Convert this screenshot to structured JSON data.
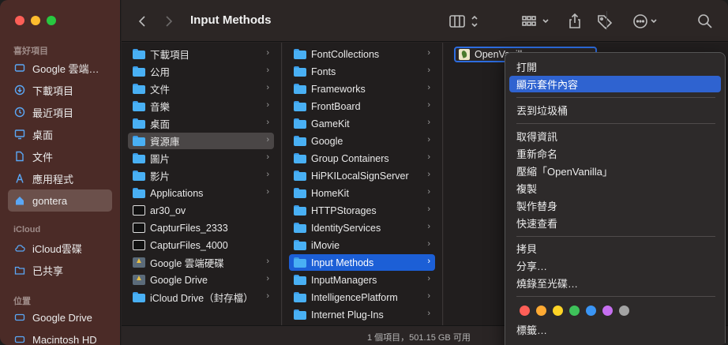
{
  "window": {
    "title": "Input Methods"
  },
  "sidebar": {
    "favorites_header": "喜好項目",
    "icloud_header": "iCloud",
    "locations_header": "位置",
    "favorites": [
      {
        "label": "Google 雲端…",
        "icon": "cloud-drive-icon"
      },
      {
        "label": "下載項目",
        "icon": "download-icon"
      },
      {
        "label": "最近項目",
        "icon": "clock-icon"
      },
      {
        "label": "桌面",
        "icon": "desktop-icon"
      },
      {
        "label": "文件",
        "icon": "document-icon"
      },
      {
        "label": "應用程式",
        "icon": "applications-icon"
      },
      {
        "label": "gontera",
        "icon": "home-icon"
      }
    ],
    "icloud": [
      {
        "label": "iCloud雲碟",
        "icon": "cloud-icon"
      },
      {
        "label": "已共享",
        "icon": "shared-folder-icon"
      }
    ],
    "locations": [
      {
        "label": "Google Drive",
        "icon": "drive-icon"
      },
      {
        "label": "Macintosh HD",
        "icon": "disk-icon"
      }
    ]
  },
  "column1": [
    {
      "label": "下載項目",
      "icon": "folder",
      "chevron": true
    },
    {
      "label": "公用",
      "icon": "folder",
      "chevron": true
    },
    {
      "label": "文件",
      "icon": "folder",
      "chevron": true
    },
    {
      "label": "音樂",
      "icon": "folder",
      "chevron": true
    },
    {
      "label": "桌面",
      "icon": "folder",
      "chevron": true
    },
    {
      "label": "資源庫",
      "icon": "folder",
      "chevron": true,
      "selected": true
    },
    {
      "label": "圖片",
      "icon": "folder",
      "chevron": true
    },
    {
      "label": "影片",
      "icon": "folder",
      "chevron": true
    },
    {
      "label": "Applications",
      "icon": "folder",
      "chevron": true
    },
    {
      "label": "ar30_ov",
      "icon": "file",
      "chevron": false
    },
    {
      "label": "CapturFiles_2333",
      "icon": "file",
      "chevron": false
    },
    {
      "label": "CapturFiles_4000",
      "icon": "file",
      "chevron": false
    },
    {
      "label": "Google 雲端硬碟",
      "icon": "gdrive",
      "chevron": true
    },
    {
      "label": "Google Drive",
      "icon": "gdrive",
      "chevron": true
    },
    {
      "label": "iCloud Drive（封存檔）",
      "icon": "folder",
      "chevron": true
    }
  ],
  "column2": [
    {
      "label": "FontCollections"
    },
    {
      "label": "Fonts"
    },
    {
      "label": "Frameworks"
    },
    {
      "label": "FrontBoard"
    },
    {
      "label": "GameKit"
    },
    {
      "label": "Google"
    },
    {
      "label": "Group Containers"
    },
    {
      "label": "HiPKILocalSignServer"
    },
    {
      "label": "HomeKit"
    },
    {
      "label": "HTTPStorages"
    },
    {
      "label": "IdentityServices"
    },
    {
      "label": "iMovie"
    },
    {
      "label": "Input Methods",
      "selected": true
    },
    {
      "label": "InputManagers"
    },
    {
      "label": "IntelligencePlatform"
    },
    {
      "label": "Internet Plug-Ins"
    }
  ],
  "column3": {
    "item_label": "OpenVanilla",
    "item_icon": "app-icon"
  },
  "context_menu": {
    "items": [
      {
        "label": "打開"
      },
      {
        "label": "顯示套件內容",
        "highlighted": true
      },
      {
        "label": "丟到垃圾桶"
      },
      {
        "label": "取得資訊"
      },
      {
        "label": "重新命名"
      },
      {
        "label": "壓縮「OpenVanilla」"
      },
      {
        "label": "複製"
      },
      {
        "label": "製作替身"
      },
      {
        "label": "快速查看"
      },
      {
        "label": "拷貝"
      },
      {
        "label": "分享…"
      },
      {
        "label": "燒錄至光碟…"
      },
      {
        "label": "標籤…"
      }
    ],
    "tag_colors": [
      "#ff5f57",
      "#ffaa33",
      "#ffd426",
      "#3ec25a",
      "#3a95f5",
      "#c66ff0",
      "#a3a3a3"
    ]
  },
  "statusbar": {
    "text": "1 個項目，501.15 GB 可用"
  }
}
